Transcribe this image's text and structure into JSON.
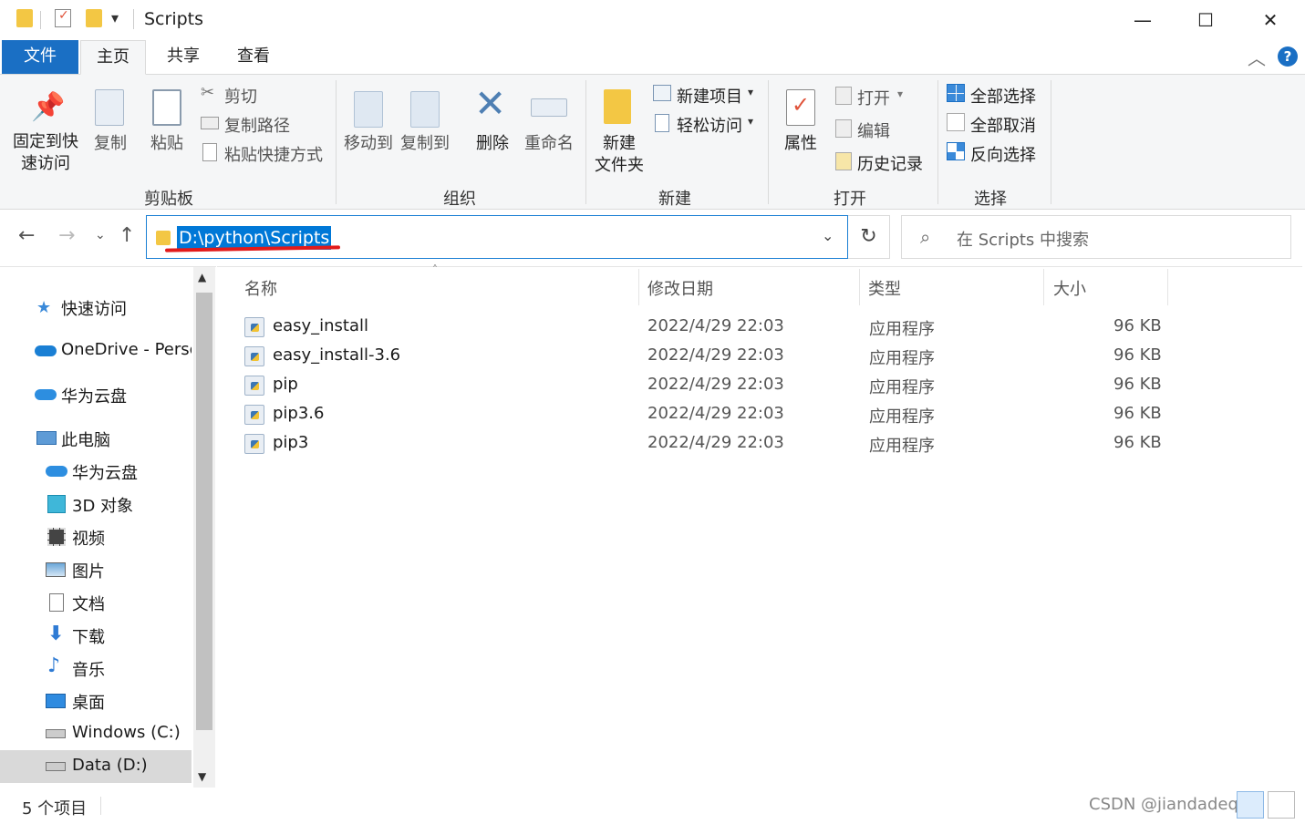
{
  "window": {
    "title": "Scripts",
    "quick_access_dropdown": "▾",
    "minimize": "—",
    "maximize": "☐",
    "close": "✕"
  },
  "tabs": {
    "file": "文件",
    "home": "主页",
    "share": "共享",
    "view": "查看",
    "help": "?"
  },
  "ribbon": {
    "clipboard": {
      "label": "剪贴板",
      "pin_line1": "固定到快",
      "pin_line2": "速访问",
      "copy": "复制",
      "paste": "粘贴",
      "cut": "剪切",
      "copy_path": "复制路径",
      "paste_shortcut": "粘贴快捷方式"
    },
    "organize": {
      "label": "组织",
      "move_to": "移动到",
      "copy_to": "复制到",
      "delete": "删除",
      "rename": "重命名"
    },
    "new": {
      "label": "新建",
      "new_folder_line1": "新建",
      "new_folder_line2": "文件夹",
      "new_item": "新建项目",
      "easy_access": "轻松访问"
    },
    "open": {
      "label": "打开",
      "properties": "属性",
      "open": "打开",
      "edit": "编辑",
      "history": "历史记录"
    },
    "select": {
      "label": "选择",
      "select_all": "全部选择",
      "select_none": "全部取消",
      "invert": "反向选择"
    }
  },
  "address": {
    "path": "D:\\python\\Scripts",
    "search_placeholder": "在 Scripts 中搜索"
  },
  "nav": {
    "items": [
      {
        "label": "快速访问",
        "icon": "star-icon"
      },
      {
        "label": "OneDrive - Persc",
        "icon": "cloud-icon"
      },
      {
        "label": "华为云盘",
        "icon": "cloud-icon"
      },
      {
        "label": "此电脑",
        "icon": "computer-icon"
      },
      {
        "label": "华为云盘",
        "icon": "cloud-icon"
      },
      {
        "label": "3D 对象",
        "icon": "cube-icon"
      },
      {
        "label": "视频",
        "icon": "film-icon"
      },
      {
        "label": "图片",
        "icon": "picture-icon"
      },
      {
        "label": "文档",
        "icon": "document-icon"
      },
      {
        "label": "下载",
        "icon": "download-icon"
      },
      {
        "label": "音乐",
        "icon": "music-icon"
      },
      {
        "label": "桌面",
        "icon": "desktop-icon"
      },
      {
        "label": "Windows (C:)",
        "icon": "drive-icon"
      },
      {
        "label": "Data (D:)",
        "icon": "drive-icon"
      }
    ]
  },
  "files": {
    "columns": {
      "name": "名称",
      "modified": "修改日期",
      "type": "类型",
      "size": "大小"
    },
    "rows": [
      {
        "name": "easy_install",
        "modified": "2022/4/29 22:03",
        "type": "应用程序",
        "size": "96 KB"
      },
      {
        "name": "easy_install-3.6",
        "modified": "2022/4/29 22:03",
        "type": "应用程序",
        "size": "96 KB"
      },
      {
        "name": "pip",
        "modified": "2022/4/29 22:03",
        "type": "应用程序",
        "size": "96 KB"
      },
      {
        "name": "pip3.6",
        "modified": "2022/4/29 22:03",
        "type": "应用程序",
        "size": "96 KB"
      },
      {
        "name": "pip3",
        "modified": "2022/4/29 22:03",
        "type": "应用程序",
        "size": "96 KB"
      }
    ]
  },
  "status": {
    "count": "5 个项目",
    "watermark": "CSDN @jiandadeqiu"
  },
  "colors": {
    "accent": "#1a6fc4",
    "selection": "#0078d7",
    "annotation_underline": "#e21a1a",
    "folder": "#f3c744"
  }
}
